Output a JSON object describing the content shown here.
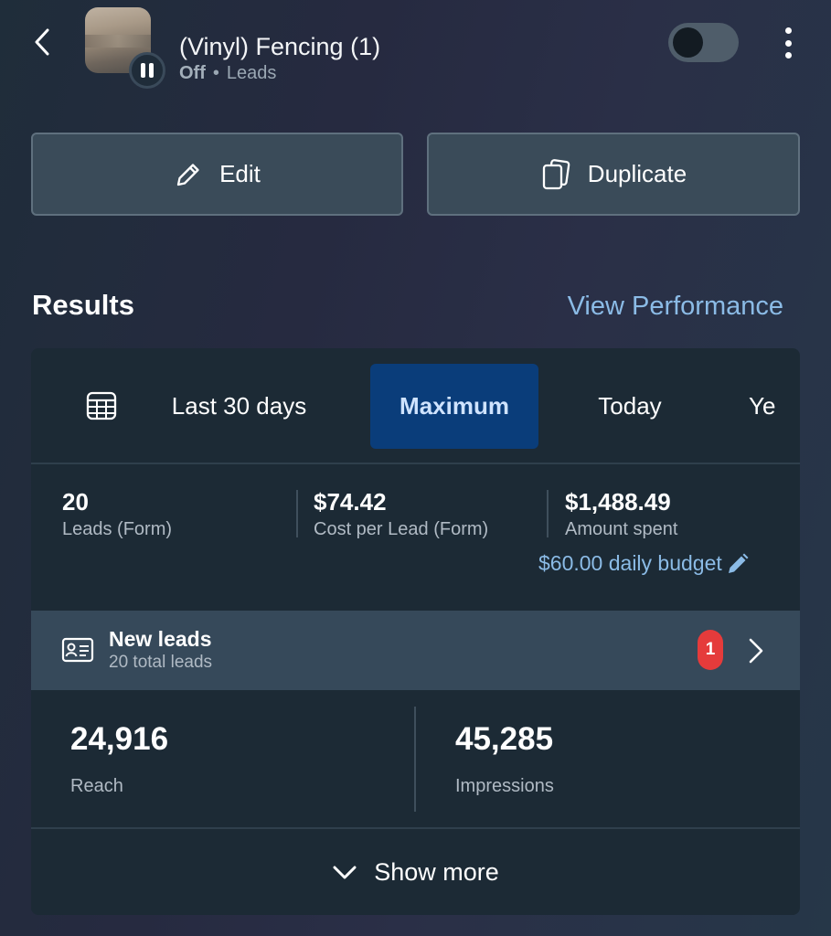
{
  "header": {
    "campaign_name": "(Vinyl) Fencing (1)",
    "status": "Off",
    "separator": "•",
    "objective": "Leads"
  },
  "actions": {
    "edit_label": "Edit",
    "duplicate_label": "Duplicate"
  },
  "results": {
    "title": "Results",
    "view_performance": "View Performance"
  },
  "date_tabs": {
    "items": [
      "Last 30 days",
      "Maximum",
      "Today",
      "Ye"
    ],
    "selected": "Maximum"
  },
  "metrics": [
    {
      "value": "20",
      "label": "Leads (Form)"
    },
    {
      "value": "$74.42",
      "label": "Cost per Lead (Form)"
    },
    {
      "value": "$1,488.49",
      "label": "Amount spent"
    }
  ],
  "budget": {
    "label": "$60.00 daily budget"
  },
  "new_leads": {
    "title": "New leads",
    "subtitle": "20 total leads",
    "badge": "1"
  },
  "stats": [
    {
      "value": "24,916",
      "label": "Reach"
    },
    {
      "value": "45,285",
      "label": "Impressions"
    }
  ],
  "show_more": "Show more",
  "colors": {
    "accent_link": "#8bbbe6",
    "selected_tab_bg": "#0a3d7a",
    "badge_red": "#e53b3b",
    "card_bg": "#1c2a35",
    "leads_row_bg": "#36495a"
  },
  "icons": [
    "back-chevron-icon",
    "pause-icon",
    "more-vertical-icon",
    "pencil-icon",
    "duplicate-icon",
    "calendar-grid-icon",
    "lead-card-icon",
    "chevron-right-icon",
    "chevron-down-icon"
  ]
}
